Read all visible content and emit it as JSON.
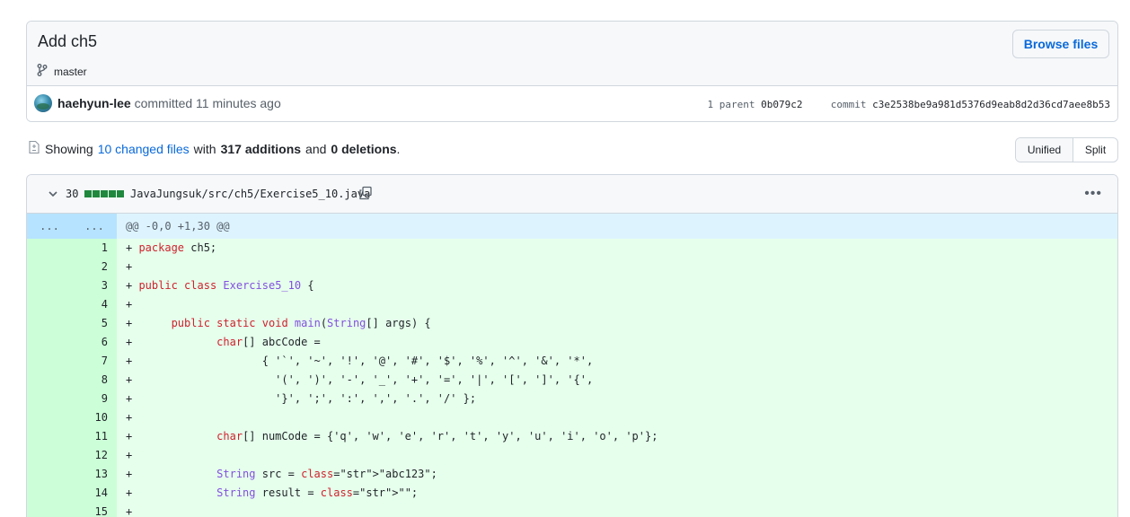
{
  "commit": {
    "title": "Add ch5",
    "branch": "master",
    "browse_label": "Browse files",
    "author": "haehyun-lee",
    "action": " committed 11 minutes ago",
    "parent_label": "1 parent",
    "parent_sha": "0b079c2",
    "commit_label": "commit",
    "commit_sha": "c3e2538be9a981d5376d9eab8d2d36cd7aee8b53"
  },
  "summary": {
    "showing": "Showing",
    "changed_files": "10 changed files",
    "with": "with",
    "additions": "317 additions",
    "and": "and",
    "deletions": "0 deletions",
    "period": "."
  },
  "view": {
    "unified": "Unified",
    "split": "Split",
    "selected": "Unified"
  },
  "file": {
    "count": "30",
    "path": "JavaJungsuk/src/ch5/Exercise5_10.java",
    "hunk_left": "...",
    "hunk_right": "...",
    "hunk": "@@ -0,0 +1,30 @@",
    "lines": [
      {
        "n": "1",
        "t": "+ package ch5;"
      },
      {
        "n": "2",
        "t": "+"
      },
      {
        "n": "3",
        "t": "+ public class Exercise5_10 {"
      },
      {
        "n": "4",
        "t": "+"
      },
      {
        "n": "5",
        "t": "+      public static void main(String[] args) {"
      },
      {
        "n": "6",
        "t": "+             char[] abcCode ="
      },
      {
        "n": "7",
        "t": "+                    { '`', '~', '!', '@', '#', '$', '%', '^', '&', '*',"
      },
      {
        "n": "8",
        "t": "+                      '(', ')', '-', '_', '+', '=', '|', '[', ']', '{',"
      },
      {
        "n": "9",
        "t": "+                      '}', ';', ':', ',', '.', '/' };"
      },
      {
        "n": "10",
        "t": "+"
      },
      {
        "n": "11",
        "t": "+             char[] numCode = {'q', 'w', 'e', 'r', 't', 'y', 'u', 'i', 'o', 'p'};"
      },
      {
        "n": "12",
        "t": "+"
      },
      {
        "n": "13",
        "t": "+             String src = \"abc123\";"
      },
      {
        "n": "14",
        "t": "+             String result = \"\";"
      },
      {
        "n": "15",
        "t": "+"
      }
    ]
  },
  "colors": {
    "link": "#0969da",
    "addition_block": "#1f883d",
    "added_line_bg": "#e6ffec",
    "added_gutter_bg": "#ccffd8",
    "hunk_bg": "#ddf4ff"
  },
  "icons": [
    "git-branch-icon",
    "file-diff-icon",
    "chevron-down-icon",
    "copy-icon",
    "kebab-horizontal-icon"
  ]
}
